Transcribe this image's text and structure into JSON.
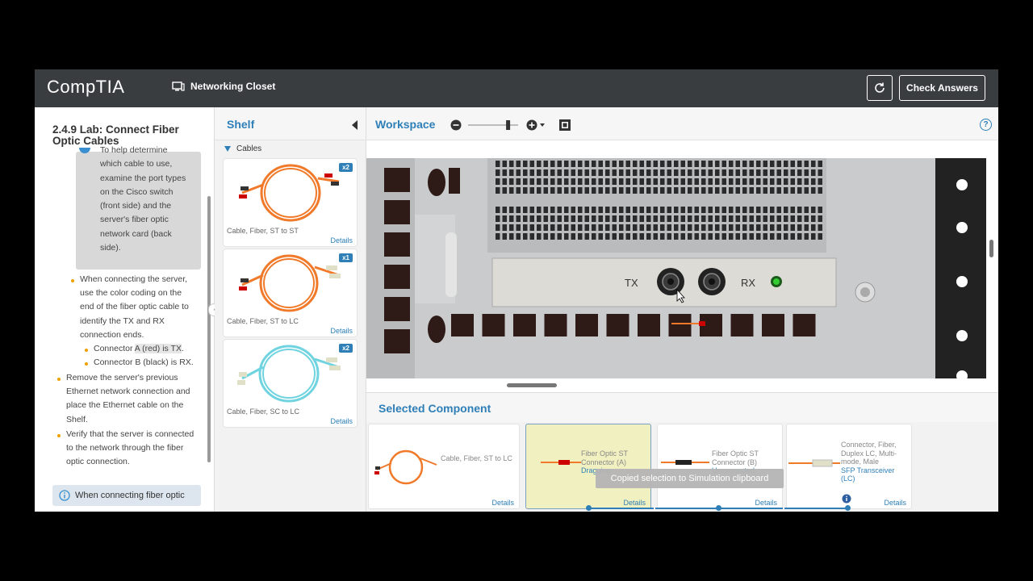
{
  "header": {
    "logo": "CompTIA",
    "location_label": "Networking Closet",
    "check_answers": "Check Answers",
    "icons": {
      "location": "monitor-icon",
      "refresh": "refresh-icon"
    }
  },
  "lab": {
    "title": "2.4.9 Lab: Connect Fiber Optic Cables",
    "tip_lines": [
      "To help determine",
      "which cable to use,",
      "examine the port types",
      "on the Cisco switch",
      "(front side) and the",
      "server's fiber optic",
      "network card (back",
      "side)."
    ],
    "bullet1_lines": [
      "When connecting the server,",
      "use the color coding on the",
      "end of the fiber optic cable to",
      "identify the TX and RX",
      "connection ends."
    ],
    "sub1_prefix": "Connector",
    "sub1_highlight": "A (red) is TX",
    "sub1_suffix": ".",
    "sub2": "Connector B (black) is RX.",
    "bullet2_lines": [
      "Remove the server's previous",
      "Ethernet network connection and",
      "place the Ethernet cable on the",
      "Shelf."
    ],
    "bullet3_lines": [
      "Verify that the server is connected",
      "to the network through the fiber",
      "optic connection."
    ],
    "info_text": "When connecting fiber optic"
  },
  "shelf": {
    "title": "Shelf",
    "group": "Cables",
    "items": [
      {
        "name": "Cable, Fiber, ST to ST",
        "count": "x2",
        "details": "Details"
      },
      {
        "name": "Cable, Fiber, ST to LC",
        "count": "x1",
        "details": "Details"
      },
      {
        "name": "Cable, Fiber, SC to LC",
        "count": "x2",
        "details": "Details"
      }
    ]
  },
  "workspace": {
    "title": "Workspace",
    "zoom_level": 0.8,
    "tx_label": "TX",
    "rx_label": "RX"
  },
  "selected": {
    "title": "Selected Component",
    "cards": [
      {
        "name": "Cable, Fiber, ST to LC",
        "details": "Details"
      },
      {
        "lines": [
          "Fiber Optic ST",
          "Connector (A)"
        ],
        "status": "Dragging",
        "details": "Details"
      },
      {
        "lines": [
          "Fiber Optic ST",
          "Connector (B)"
        ],
        "status": "Unconnected",
        "details": "Details"
      },
      {
        "lines": [
          "Connector, Fiber,",
          "Duplex LC, Multi-",
          "mode, Male"
        ],
        "status_lines": [
          "SFP Transceiver",
          "(LC)"
        ],
        "details": "Details"
      }
    ],
    "toast": "Copied selection to Simulation clipboard"
  },
  "colors": {
    "accent": "#2e7fb8",
    "topbar": "#3a3d40",
    "bullet": "#f0a000",
    "fiber_orange": "#f07a2a",
    "fiber_aqua": "#6fd3e0"
  }
}
